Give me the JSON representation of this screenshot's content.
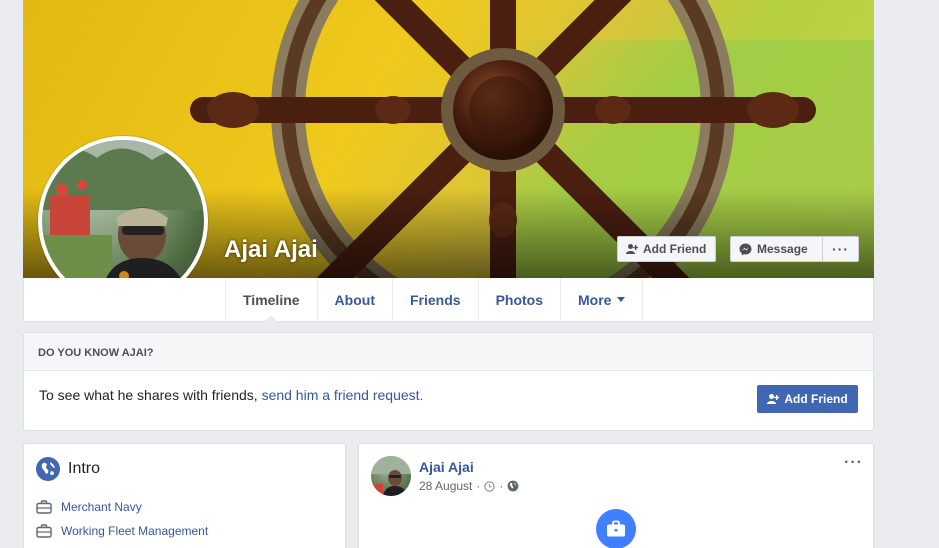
{
  "profile": {
    "name": "Ajai Ajai"
  },
  "cover_actions": {
    "add_friend": "Add Friend",
    "message": "Message",
    "more": "···"
  },
  "tabs": [
    {
      "label": "Timeline",
      "active": true
    },
    {
      "label": "About",
      "active": false
    },
    {
      "label": "Friends",
      "active": false
    },
    {
      "label": "Photos",
      "active": false
    },
    {
      "label": "More",
      "active": false
    }
  ],
  "know_card": {
    "heading": "DO YOU KNOW AJAI?",
    "text": "To see what he shares with friends,",
    "link": "send him a friend request.",
    "button": "Add Friend"
  },
  "intro": {
    "title": "Intro",
    "items": [
      {
        "icon": "briefcase-icon",
        "label": "Merchant Navy"
      },
      {
        "icon": "briefcase-icon",
        "label": "Working Fleet Management"
      }
    ]
  },
  "post": {
    "author": "Ajai Ajai",
    "date": "28 August",
    "separator": "·",
    "menu": "···",
    "icons": [
      "clock-icon",
      "globe-icon",
      "briefcase-icon"
    ]
  },
  "colors": {
    "brand_blue": "#4267b2",
    "link_blue": "#365899",
    "page_bg": "#e9ebee"
  }
}
